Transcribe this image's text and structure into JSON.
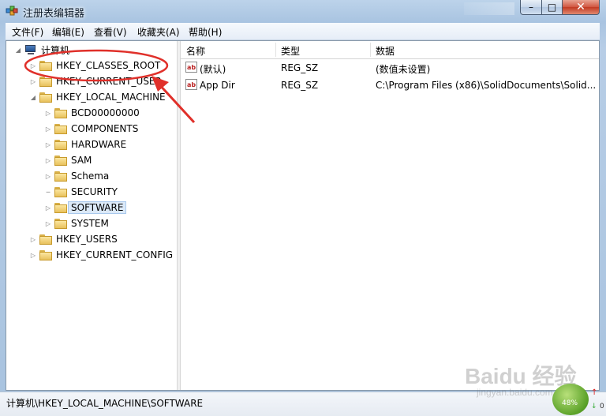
{
  "window": {
    "title": "注册表编辑器",
    "app_icon": "registry-editor-icon"
  },
  "menu": [
    {
      "label": "文件(F)"
    },
    {
      "label": "编辑(E)"
    },
    {
      "label": "查看(V)"
    },
    {
      "label": "收藏夹(A)"
    },
    {
      "label": "帮助(H)"
    }
  ],
  "tree": {
    "root": "计算机",
    "nodes": [
      {
        "label": "HKEY_CLASSES_ROOT"
      },
      {
        "label": "HKEY_CURRENT_USER"
      },
      {
        "label": "HKEY_LOCAL_MACHINE"
      },
      {
        "label": "BCD00000000"
      },
      {
        "label": "COMPONENTS"
      },
      {
        "label": "HARDWARE"
      },
      {
        "label": "SAM"
      },
      {
        "label": "Schema"
      },
      {
        "label": "SECURITY"
      },
      {
        "label": "SOFTWARE",
        "selected": true
      },
      {
        "label": "SYSTEM"
      },
      {
        "label": "HKEY_USERS"
      },
      {
        "label": "HKEY_CURRENT_CONFIG"
      }
    ]
  },
  "list": {
    "columns": [
      "名称",
      "类型",
      "数据"
    ],
    "rows": [
      {
        "name": "(默认)",
        "type": "REG_SZ",
        "data": "(数值未设置)"
      },
      {
        "name": "App Dir",
        "type": "REG_SZ",
        "data": "C:\\Program Files (x86)\\SolidDocuments\\Solid..."
      }
    ]
  },
  "status": {
    "path": "计算机\\HKEY_LOCAL_MACHINE\\SOFTWARE"
  },
  "overlay": {
    "watermark": "Baidu 经验",
    "watermark_sub": "jingyan.baidu.com",
    "badge_percent": "48%",
    "counter": "0",
    "annotation_color": "#e0302a"
  }
}
